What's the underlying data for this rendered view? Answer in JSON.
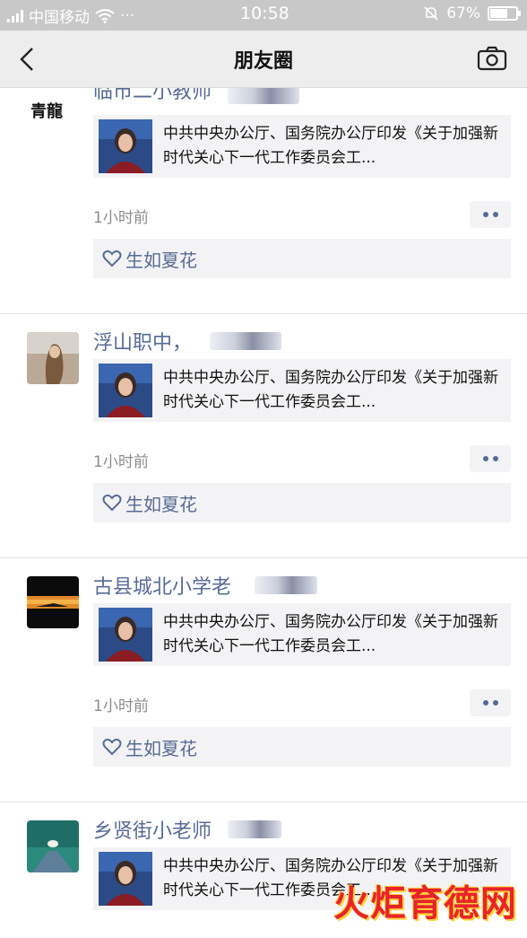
{
  "status_bar": {
    "carrier": "中国移动",
    "more": "···",
    "time": "10:58",
    "battery": "67%",
    "battery_level": 0.67,
    "icons": [
      "signal-icon",
      "wifi-icon",
      "mute-bell-icon",
      "battery-icon"
    ]
  },
  "nav": {
    "title": "朋友圈",
    "back_icon": "chevron-left-icon",
    "camera_icon": "camera-icon"
  },
  "avatar_glyph": "青龍",
  "moments": [
    {
      "name": "临市二小教师",
      "link_title": "中共中央办公厅、国务院办公厅印发《关于加强新时代关心下一代工作委员会工...",
      "time": "1小时前",
      "liker": "生如夏花"
    },
    {
      "name": "浮山职中，",
      "link_title": "中共中央办公厅、国务院办公厅印发《关于加强新时代关心下一代工作委员会工...",
      "time": "1小时前",
      "liker": "生如夏花"
    },
    {
      "name": "古县城北小学老",
      "link_title": "中共中央办公厅、国务院办公厅印发《关于加强新时代关心下一代工作委员会工...",
      "time": "1小时前",
      "liker": "生如夏花"
    },
    {
      "name": "乡贤街小老师",
      "link_title": "中共中央办公厅、国务院办公厅印发《关于加强新时代关心下一代工作委员会工...",
      "time": "",
      "liker": ""
    }
  ],
  "watermark": "火炬育德网",
  "colors": {
    "name_link": "#576b95",
    "card_bg": "#f3f3f5",
    "nav_bg": "#ededed",
    "watermark": "#e8232a"
  }
}
